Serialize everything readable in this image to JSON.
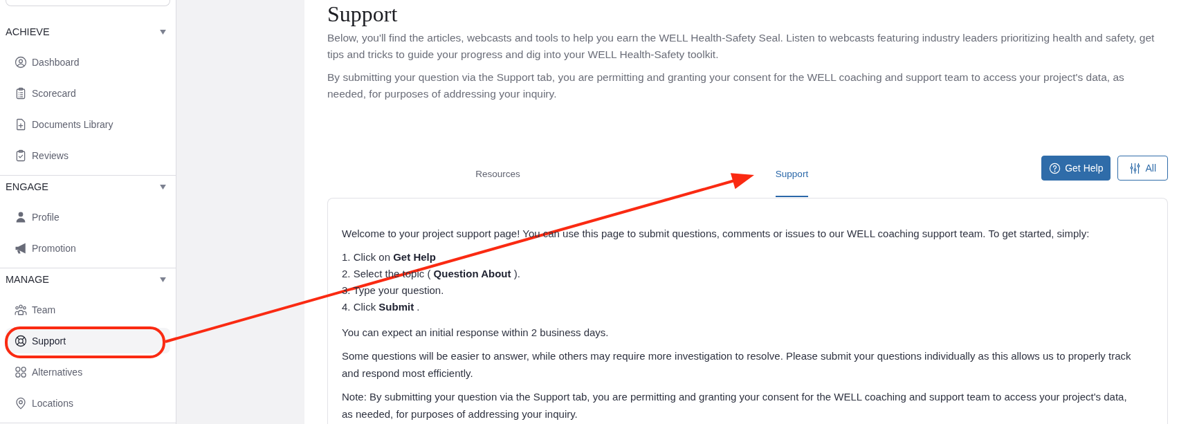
{
  "sidebar": {
    "sections": [
      {
        "title": "ACHIEVE",
        "expanded": true,
        "items": [
          {
            "label": "Dashboard",
            "selected": false
          },
          {
            "label": "Scorecard",
            "selected": false
          },
          {
            "label": "Documents Library",
            "selected": false
          },
          {
            "label": "Reviews",
            "selected": false
          }
        ]
      },
      {
        "title": "ENGAGE",
        "expanded": true,
        "items": [
          {
            "label": "Profile",
            "selected": false
          },
          {
            "label": "Promotion",
            "selected": false
          }
        ]
      },
      {
        "title": "MANAGE",
        "expanded": true,
        "items": [
          {
            "label": "Team",
            "selected": false
          },
          {
            "label": "Support",
            "selected": true
          },
          {
            "label": "Alternatives",
            "selected": false
          },
          {
            "label": "Locations",
            "selected": false
          }
        ]
      }
    ]
  },
  "page": {
    "title": "Support",
    "intro": [
      "Below, you'll find the articles, webcasts and tools to help you earn the WELL Health-Safety Seal. Listen to webcasts featuring industry leaders prioritizing health and safety, get tips and tricks to guide your progress and dig into your WELL Health-Safety toolkit.",
      "By submitting your question via the Support tab, you are permitting and granting your consent for the WELL coaching and support team to access your project's data, as needed, for purposes of addressing your inquiry."
    ]
  },
  "tabs": [
    {
      "label": "Resources",
      "selected": false
    },
    {
      "label": "Support",
      "selected": true
    }
  ],
  "actions": [
    {
      "label": "Get Help",
      "kind": "primary"
    },
    {
      "label": "All",
      "kind": "outline"
    }
  ],
  "support_card": {
    "blocks": [
      {
        "kind": "paragraph",
        "text": "Welcome to your project support page! You can use this page to submit questions, comments or issues to our WELL coaching support team. To get started, simply:"
      },
      {
        "kind": "steps",
        "items": [
          "1. Click on **Get Help**",
          "2. Select the topic ( **Question About** ).",
          "3. Type your question.",
          "4. Click **Submit** ."
        ]
      },
      {
        "kind": "paragraph",
        "text": "You can expect an initial response within 2 business days."
      },
      {
        "kind": "paragraph",
        "text": "Some questions will be easier to answer, while others may require more investigation to resolve. Please submit your questions individually as this allows us to properly track and respond most efficiently."
      },
      {
        "kind": "paragraph",
        "text": "Note: By submitting your question via the Support tab, you are permitting and granting your consent for the WELL coaching and support team to access your project's data, as needed, for purposes of addressing your inquiry."
      }
    ]
  }
}
